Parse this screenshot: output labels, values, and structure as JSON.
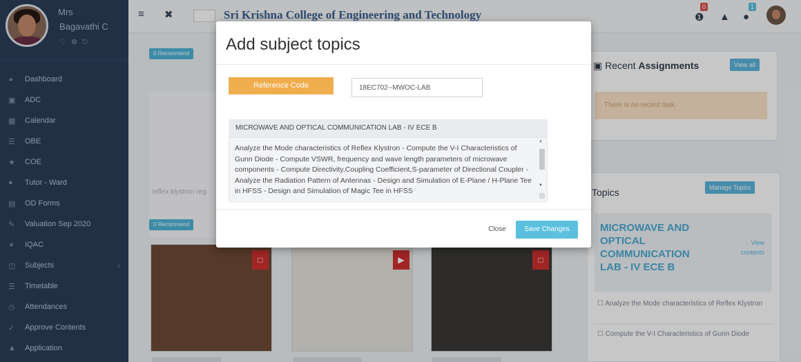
{
  "user": {
    "name_line1": "Mrs",
    "name_line2": "Bagavathi C"
  },
  "sidebar": {
    "items": [
      {
        "label": "Dashboard",
        "icon": "dashboard-icon"
      },
      {
        "label": "ADC",
        "icon": "book-icon"
      },
      {
        "label": "Calendar",
        "icon": "calendar-icon"
      },
      {
        "label": "OBE",
        "icon": "list-icon"
      },
      {
        "label": "COE",
        "icon": "badge-icon"
      },
      {
        "label": "Tutor - Ward",
        "icon": "users-icon"
      },
      {
        "label": "OD Forms",
        "icon": "form-icon"
      },
      {
        "label": "Valuation Sep 2020",
        "icon": "edit-icon"
      },
      {
        "label": "IQAC",
        "icon": "star-icon"
      },
      {
        "label": "Subjects",
        "icon": "book-open-icon"
      },
      {
        "label": "Timetable",
        "icon": "table-icon"
      },
      {
        "label": "Attendances",
        "icon": "clock-icon"
      },
      {
        "label": "Approve Contents",
        "icon": "check-icon"
      },
      {
        "label": "Application",
        "icon": "app-icon"
      }
    ]
  },
  "header": {
    "college_name": "Sri Krishna College of Engineering and Technology",
    "notification_count": "0",
    "message_count": "1"
  },
  "main": {
    "tag1": "0 Recommend",
    "tag2": "0 Recommend",
    "left_caption": "reflex klystron reg"
  },
  "right": {
    "assignments_title_prefix": "Recent",
    "assignments_title_bold": "Assignments",
    "view_all": "View all",
    "no_assignments": "There is no recent task.",
    "topics_title": "Topics",
    "manage_topics": "Manage Topics",
    "subject_name": "MICROWAVE AND OPTICAL COMMUNICATION LAB - IV ECE B",
    "view_contents": "View contents",
    "topic_items": [
      "☐ Analyze the Mode characteristics of Reflex Klystron",
      "☐ Compute the V-I Characteristics of Gunn Diode"
    ]
  },
  "modal": {
    "title": "Add subject topics",
    "reference_label": "Reference Code",
    "reference_value": "18EC702--MWOC-LAB",
    "subject": "MICROWAVE AND OPTICAL COMMUNICATION LAB - IV ECE B",
    "topics_text": "Analyze the Mode characteristics of Reflex Klystron - Compute the V-I Characteristics of Gunn Diode - Compute VSWR, frequency and wave length parameters of microwave components - Compute Directivity,Coupling Coefficient,S-parameter of Directional Coupler - Analyze the Radiation Pattern of Antennas - Design and Simulation of E-Plane / H-Plane Tee in HFSS - Design and Simulation of Magic Tee in HFSS",
    "close_label": "Close",
    "save_label": "Save Changes"
  },
  "colors": {
    "sidebar_bg": "#2c3e5a",
    "accent_blue": "#5bc0de",
    "warning_orange": "#f0ad4e",
    "title_blue": "#3a5f8f"
  }
}
